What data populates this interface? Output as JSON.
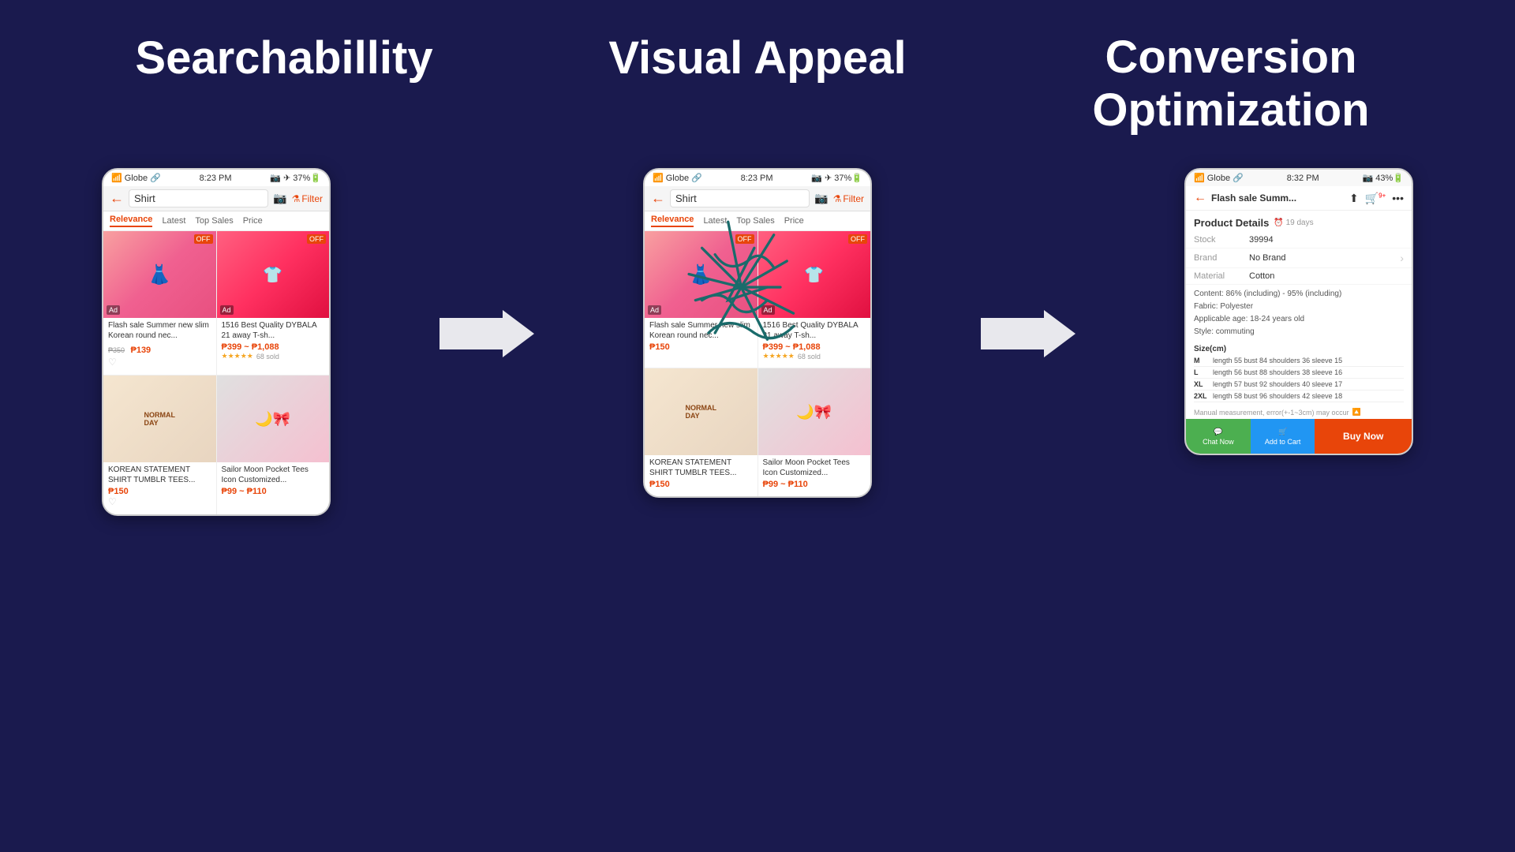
{
  "background_color": "#1a1a4e",
  "titles": {
    "searchability": "Searchabillity",
    "visual_appeal": "Visual Appeal",
    "conversion_optimization_line1": "Conversion",
    "conversion_optimization_line2": "Optimization"
  },
  "phone1": {
    "status": {
      "signal": "Globe",
      "time": "8:23 PM",
      "battery": "37%"
    },
    "search_text": "Shirt",
    "filter_label": "Filter",
    "tabs": [
      "Relevance",
      "Latest",
      "Top Sales",
      "Price"
    ],
    "active_tab": "Relevance",
    "products": [
      {
        "title": "Flash sale Summer new slim Korean round nec...",
        "price": "₱139",
        "old_price": "₱350",
        "badge": "OFF",
        "ad": true,
        "type": "shirt"
      },
      {
        "title": "1516 Best Quality DYBALA 21 away  T-sh...",
        "price_range": "₱399 ~ ₱1,088",
        "badge": "OFF",
        "ad": true,
        "stars": "★★★★★",
        "sold": "68 sold",
        "type": "tshirt"
      },
      {
        "title": "KOREAN STATEMENT SHIRT TUMBLR TEES...",
        "price": "₱150",
        "heart": true,
        "type": "normal_day"
      },
      {
        "title": "Sailor Moon Pocket Tees Icon Customized...",
        "price_range": "₱99 ~ ₱110",
        "type": "sailor"
      }
    ]
  },
  "phone2": {
    "status": {
      "signal": "Globe",
      "time": "8:23 PM",
      "battery": "37%"
    },
    "search_text": "Shirt",
    "filter_label": "Filter",
    "tabs": [
      "Relevance",
      "Latest",
      "Top Sales",
      "Price"
    ],
    "active_tab": "Relevance",
    "has_scribble": true,
    "products": [
      {
        "title": "Flash sale Summer new slim Korean round nec...",
        "price": "₱150",
        "badge": "OFF",
        "ad": true,
        "type": "shirt"
      },
      {
        "title": "1516 Best Quality DYBALA 21 away  T-sh...",
        "price_range": "₱399 ~ ₱1,088",
        "badge": "OFF",
        "ad": true,
        "stars": "★★★★★",
        "sold": "68 sold",
        "type": "tshirt"
      },
      {
        "title": "KOREAN STATEMENT SHIRT TUMBLR TEES...",
        "price": "₱150",
        "type": "normal_day"
      },
      {
        "title": "Sailor Moon Pocket Tees Icon Customized...",
        "price_range": "₱99 ~ ₱110",
        "type": "sailor"
      }
    ]
  },
  "phone3": {
    "status": {
      "signal": "Globe",
      "time": "8:32 PM",
      "battery": "43%"
    },
    "header_title": "Flash sale Summ...",
    "section_title": "Product Details",
    "days_badge": "⏰ 19 days",
    "details": [
      {
        "label": "Stock",
        "value": "39994"
      },
      {
        "label": "Brand",
        "value": "No Brand",
        "has_arrow": true
      },
      {
        "label": "Material",
        "value": "Cotton"
      }
    ],
    "description": {
      "content": "Content: 86% (including) - 95% (including)",
      "fabric": "Fabric: Polyester",
      "age": "Applicable age: 18-24 years old",
      "style": "Style: commuting"
    },
    "size_title": "Size(cm)",
    "sizes": [
      {
        "size": "M",
        "data": "length  55  bust   84  shoulders  36  sleeve 15"
      },
      {
        "size": "L",
        "data": "length  56  bust   88  shoulders  38  sleeve 16"
      },
      {
        "size": "XL",
        "data": "length  57  bust   92  shoulders  40  sleeve 17"
      },
      {
        "size": "2XL",
        "data": "length  58  bust   96  shoulders  42  sleeve 18"
      }
    ],
    "measurement_note": "Manual measurement, error(+-1~3cm) may occur",
    "buttons": {
      "chat": "Chat Now",
      "cart": "Add to Cart",
      "buy": "Buy Now"
    }
  }
}
